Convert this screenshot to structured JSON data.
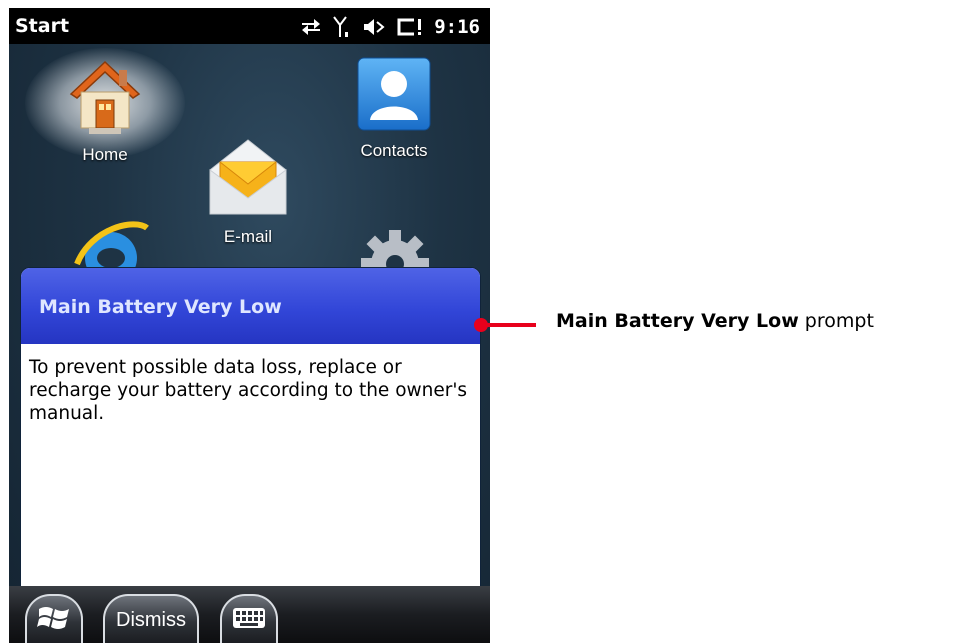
{
  "statusbar": {
    "title": "Start",
    "time": "9:16",
    "icons": [
      "connection-arrows-icon",
      "signal-antenna-icon",
      "speaker-muted-icon",
      "battery-critical-icon"
    ]
  },
  "tiles": {
    "home": {
      "label": "Home",
      "icon": "house-icon"
    },
    "email": {
      "label": "E-mail",
      "icon": "envelope-icon"
    },
    "contacts": {
      "label": "Contacts",
      "icon": "contact-person-icon"
    },
    "internet": {
      "icon": "internet-explorer-icon"
    },
    "settings": {
      "icon": "gear-icon"
    }
  },
  "dialog": {
    "title": "Main Battery Very Low",
    "message": "To prevent possible data loss, replace or recharge your battery according to the owner's manual."
  },
  "taskbar": {
    "start_icon": "windows-logo-icon",
    "dismiss_label": "Dismiss",
    "keyboard_icon": "keyboard-icon"
  },
  "callout": {
    "bold": "Main Battery Very Low",
    "rest": " prompt",
    "color": "#e8001c"
  }
}
